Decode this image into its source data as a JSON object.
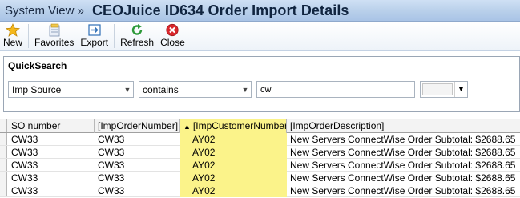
{
  "titlebar": {
    "breadcrumb": "System View »",
    "title": "CEOJuice ID634 Order Import Details"
  },
  "toolbar": {
    "buttons": [
      {
        "label": "New",
        "icon": "star-icon"
      },
      {
        "label": "Favorites",
        "icon": "favorites-icon"
      },
      {
        "label": "Export",
        "icon": "export-icon"
      },
      {
        "label": "Refresh",
        "icon": "refresh-icon"
      },
      {
        "label": "Close",
        "icon": "close-icon"
      }
    ]
  },
  "quicksearch": {
    "title": "QuickSearch",
    "field": "Imp Source",
    "operator": "contains",
    "value": "cw"
  },
  "grid": {
    "columns": [
      "SO number",
      "[ImpOrderNumber]",
      "[ImpCustomerNumber]",
      "[ImpOrderDescription]"
    ],
    "sorted_column_index": 2,
    "rows": [
      [
        "CW33",
        "CW33",
        "AY02",
        "New Servers ConnectWise Order Subtotal: $2688.65"
      ],
      [
        "CW33",
        "CW33",
        "AY02",
        "New Servers ConnectWise Order Subtotal: $2688.65"
      ],
      [
        "CW33",
        "CW33",
        "AY02",
        "New Servers ConnectWise Order Subtotal: $2688.65"
      ],
      [
        "CW33",
        "CW33",
        "AY02",
        "New Servers ConnectWise Order Subtotal: $2688.65"
      ],
      [
        "CW33",
        "CW33",
        "AY02",
        "New Servers ConnectWise Order Subtotal: $2688.65"
      ]
    ]
  },
  "colors": {
    "titlebar": "#b8cfea",
    "highlight": "#fbf38a"
  }
}
